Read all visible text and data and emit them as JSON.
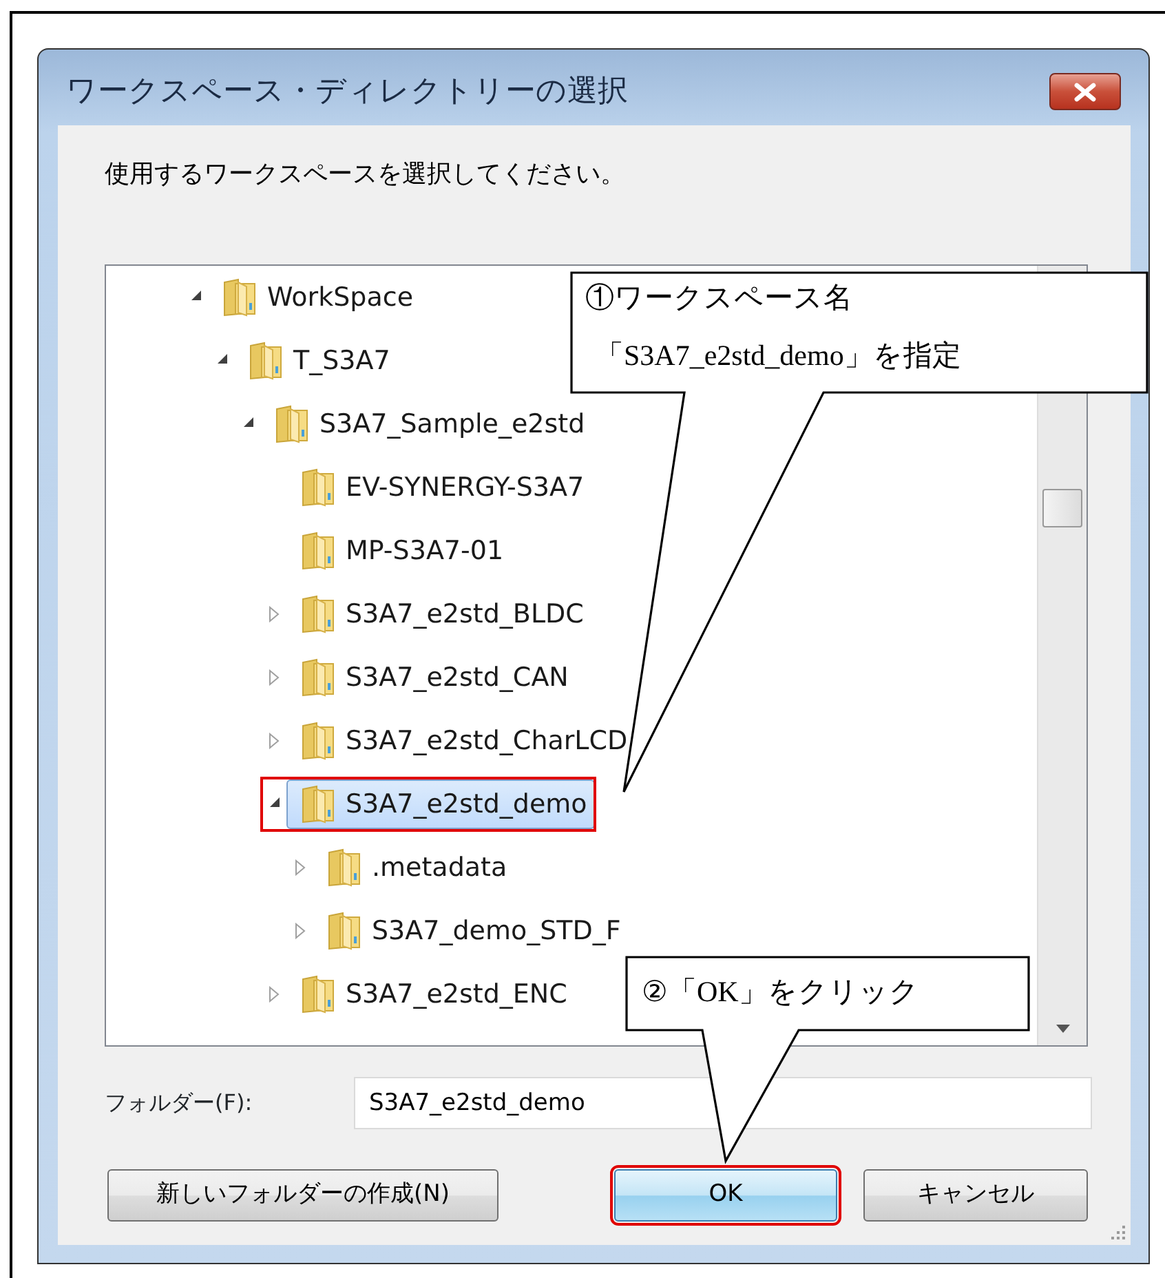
{
  "window": {
    "title": "ワークスペース・ディレクトリーの選択"
  },
  "instruction": "使用するワークスペースを選択してください。",
  "tree": [
    {
      "label": "WorkSpace",
      "expanded": true,
      "selected": false,
      "children": [
        {
          "label": "T_S3A7",
          "expanded": true,
          "selected": false,
          "children": [
            {
              "label": "S3A7_Sample_e2std",
              "expanded": true,
              "selected": false,
              "children": [
                {
                  "label": "EV-SYNERGY-S3A7",
                  "selected": false
                },
                {
                  "label": "MP-S3A7-01",
                  "selected": false
                },
                {
                  "label": "S3A7_e2std_BLDC",
                  "expanded": false,
                  "selected": false
                },
                {
                  "label": "S3A7_e2std_CAN",
                  "expanded": false,
                  "selected": false
                },
                {
                  "label": "S3A7_e2std_CharLCD",
                  "expanded": false,
                  "selected": false
                },
                {
                  "label": "S3A7_e2std_demo",
                  "expanded": true,
                  "selected": true,
                  "annotated": true,
                  "children": [
                    {
                      "label": ".metadata",
                      "expanded": false,
                      "selected": false
                    },
                    {
                      "label": "S3A7_demo_STD_F",
                      "expanded": false,
                      "selected": false
                    }
                  ]
                },
                {
                  "label": "S3A7_e2std_ENC",
                  "expanded": false,
                  "selected": false
                }
              ]
            }
          ]
        }
      ]
    }
  ],
  "folder": {
    "label": "フォルダー(F):",
    "value": "S3A7_e2std_demo"
  },
  "buttons": [
    {
      "label": "新しいフォルダーの作成(N)",
      "default": false,
      "annotated": false
    },
    {
      "label": "OK",
      "default": true,
      "annotated": true
    },
    {
      "label": "キャンセル",
      "default": false,
      "annotated": false
    }
  ],
  "callouts": [
    {
      "lines": [
        "①ワークスペース名",
        "「S3A7_e2std_demo」を指定"
      ]
    },
    {
      "lines": [
        "②「OK」をクリック"
      ]
    }
  ]
}
